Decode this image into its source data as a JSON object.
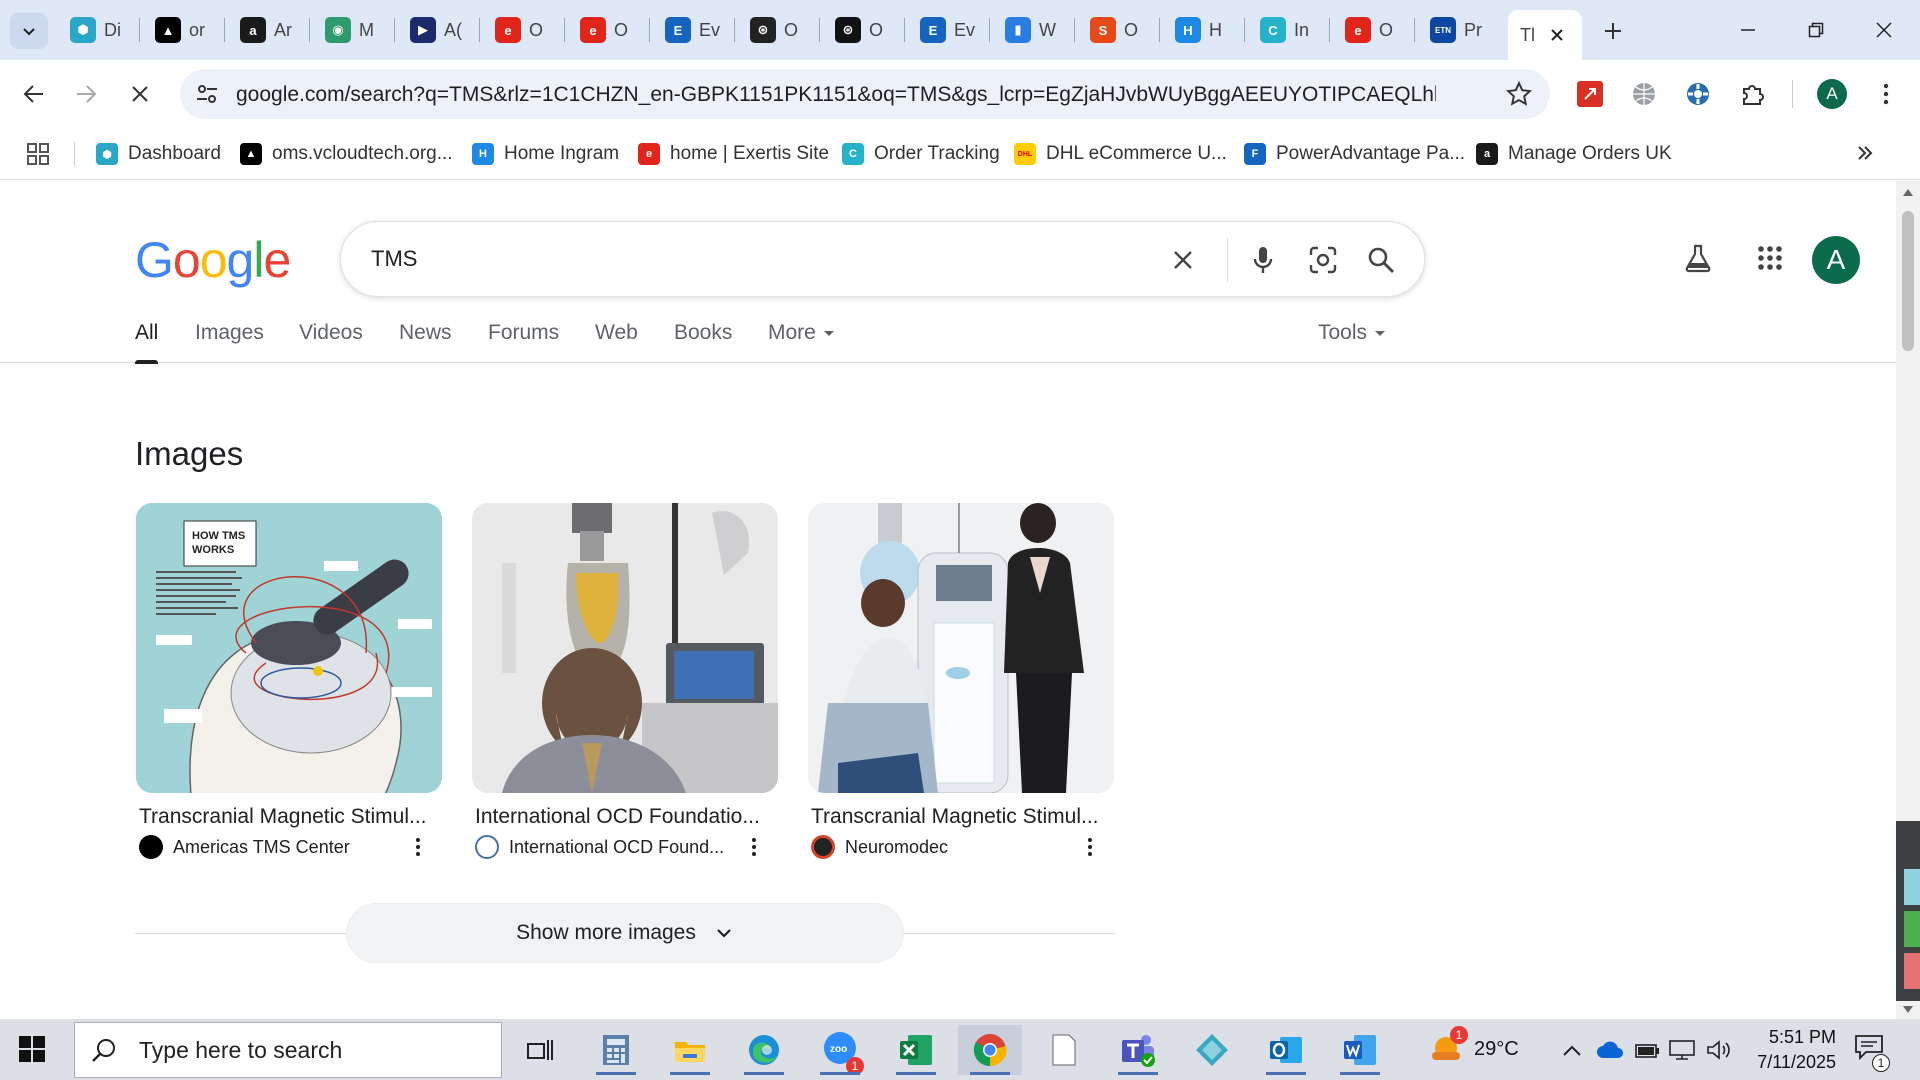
{
  "browser": {
    "tabs": [
      {
        "label": "Di",
        "fav_color": "#2aa6c9",
        "fav_char": "⬢"
      },
      {
        "label": "or",
        "fav_color": "#000000",
        "fav_char": "▲"
      },
      {
        "label": "Ar",
        "fav_color": "#1a1a1a",
        "fav_char": "a"
      },
      {
        "label": "M",
        "fav_color": "#2e9b6c",
        "fav_char": "◉"
      },
      {
        "label": "A(",
        "fav_color": "#1b2a6b",
        "fav_char": "▶"
      },
      {
        "label": "O",
        "fav_color": "#e1251b",
        "fav_char": "e"
      },
      {
        "label": "O",
        "fav_color": "#e1251b",
        "fav_char": "e"
      },
      {
        "label": "Ev",
        "fav_color": "#1565c0",
        "fav_char": "E"
      },
      {
        "label": "O",
        "fav_color": "#222222",
        "fav_char": "⊛"
      },
      {
        "label": "O",
        "fav_color": "#111111",
        "fav_char": "⊛"
      },
      {
        "label": "Ev",
        "fav_color": "#1565c0",
        "fav_char": "E"
      },
      {
        "label": "W",
        "fav_color": "#2a7de1",
        "fav_char": "▮"
      },
      {
        "label": "O",
        "fav_color": "#e64a19",
        "fav_char": "S"
      },
      {
        "label": "H",
        "fav_color": "#1e88e5",
        "fav_char": "H"
      },
      {
        "label": "In",
        "fav_color": "#26b3c9",
        "fav_char": "C"
      },
      {
        "label": "O",
        "fav_color": "#e1251b",
        "fav_char": "e"
      },
      {
        "label": "Pr",
        "fav_color": "#0d47a1",
        "fav_char": "ETN"
      }
    ],
    "active_tab": {
      "label": "Tl"
    },
    "url": "google.com/search?q=TMS&rlz=1C1CHZN_en-GBPK1151PK1151&oq=TMS&gs_lcrp=EgZjaHJvbWUyBggAEEUYOTIPCAEQLhhDGLED...",
    "profile_initial": "A",
    "bookmarks": [
      {
        "label": "Dashboard",
        "fav_color": "#2aa6c9",
        "fav_char": "⬢"
      },
      {
        "label": "oms.vcloudtech.org...",
        "fav_color": "#000000",
        "fav_char": "▲"
      },
      {
        "label": "Home Ingram",
        "fav_color": "#1e88e5",
        "fav_char": "H"
      },
      {
        "label": "home | Exertis Site",
        "fav_color": "#e1251b",
        "fav_char": "e"
      },
      {
        "label": "Order Tracking",
        "fav_color": "#26b3c9",
        "fav_char": "C"
      },
      {
        "label": "DHL eCommerce U...",
        "fav_color": "#ffcc00",
        "fav_char": "DHL"
      },
      {
        "label": "PowerAdvantage Pa...",
        "fav_color": "#1565c0",
        "fav_char": "F"
      },
      {
        "label": "Manage Orders UK",
        "fav_color": "#1a1a1a",
        "fav_char": "a"
      }
    ]
  },
  "google": {
    "query": "TMS",
    "profile_initial": "A",
    "nav": [
      "All",
      "Images",
      "Videos",
      "News",
      "Forums",
      "Web",
      "Books",
      "More"
    ],
    "tools_label": "Tools",
    "images_heading": "Images",
    "image_results": [
      {
        "title": "Transcranial Magnetic Stimul...",
        "source": "Americas TMS Center",
        "thumb_text_1": "HOW TMS",
        "thumb_text_2": "WORKS"
      },
      {
        "title": "International OCD Foundatio...",
        "source": "International OCD Found..."
      },
      {
        "title": "Transcranial Magnetic Stimul...",
        "source": "Neuromodec"
      }
    ],
    "show_more_label": "Show more images"
  },
  "taskbar": {
    "search_placeholder": "Type here to search",
    "weather": "29°C",
    "weather_badge": "1",
    "time": "5:51 PM",
    "date": "7/11/2025",
    "notification_count": "1",
    "zoom_badge": "1"
  }
}
